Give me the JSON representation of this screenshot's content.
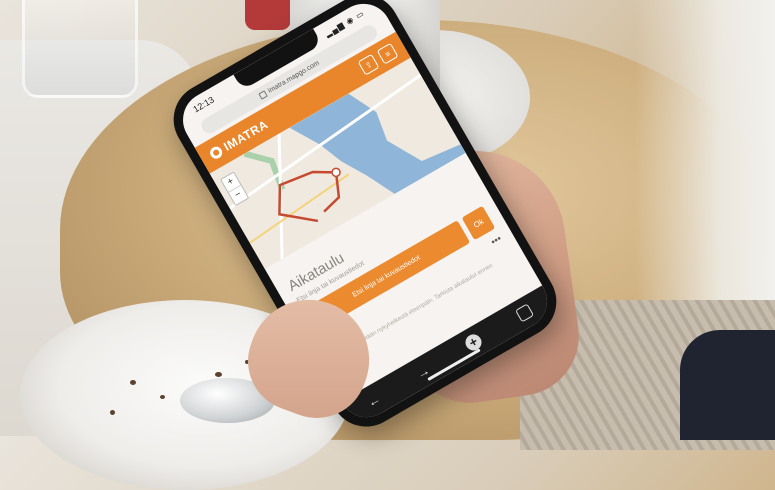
{
  "phone": {
    "time": "12:13",
    "status_icons": "▂▄▆ ◉ ▭",
    "url": "imatra.mapgo.com",
    "app_title": "IMATRA",
    "section_title": "Aikataulu",
    "hint": "Etsi linja tai kuvaustiedot",
    "select_label": "Etsi linja tai kuvaustiedot",
    "ok_label": "Ok",
    "more_label": "•••",
    "footer_text": "Lähtöajat näytetään nykyhetkestä eteenpäin. Tarkista aikataulut ennen matkaa.",
    "nav": {
      "back": "←",
      "forward": "→",
      "plus": "+"
    }
  },
  "colors": {
    "brand_orange": "#e9862c",
    "lake_blue": "#8fb5d8",
    "route_red": "#c64a30"
  }
}
